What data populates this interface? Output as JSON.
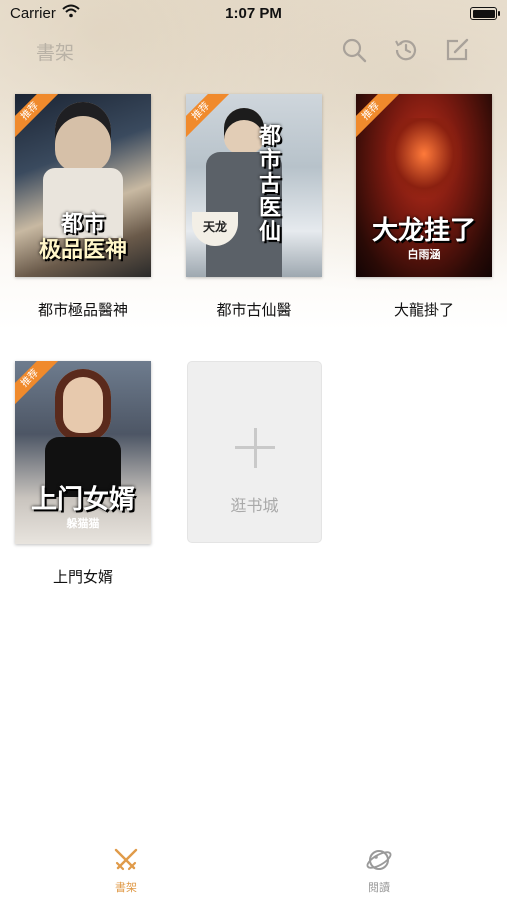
{
  "status_bar": {
    "carrier": "Carrier",
    "time": "1:07 PM"
  },
  "nav": {
    "title": "書架",
    "icons": [
      "search-icon",
      "history-icon",
      "edit-icon"
    ]
  },
  "ribbon_label": "推荐",
  "books": [
    {
      "name": "都市極品醫神",
      "cover_title_line1": "都市",
      "cover_title_line2": "极品医神"
    },
    {
      "name": "都市古仙醫",
      "cover_title": "都市古医仙",
      "cover_caption": "天龙"
    },
    {
      "name": "大龍掛了",
      "cover_title": "大龙挂了",
      "cover_author": "白雨涵"
    },
    {
      "name": "上門女婿",
      "cover_title": "上门女婿",
      "cover_author": "躲猫猫"
    }
  ],
  "add_card": {
    "label": "逛书城"
  },
  "tabs": [
    {
      "label": "書架",
      "icon": "swords-icon",
      "active": true
    },
    {
      "label": "閱讀",
      "icon": "planet-icon",
      "active": false
    }
  ],
  "colors": {
    "accent": "#e09b4a",
    "ribbon": "#f08a2c",
    "nav_icon": "#a9a29a",
    "inactive": "#9a9a9a"
  }
}
